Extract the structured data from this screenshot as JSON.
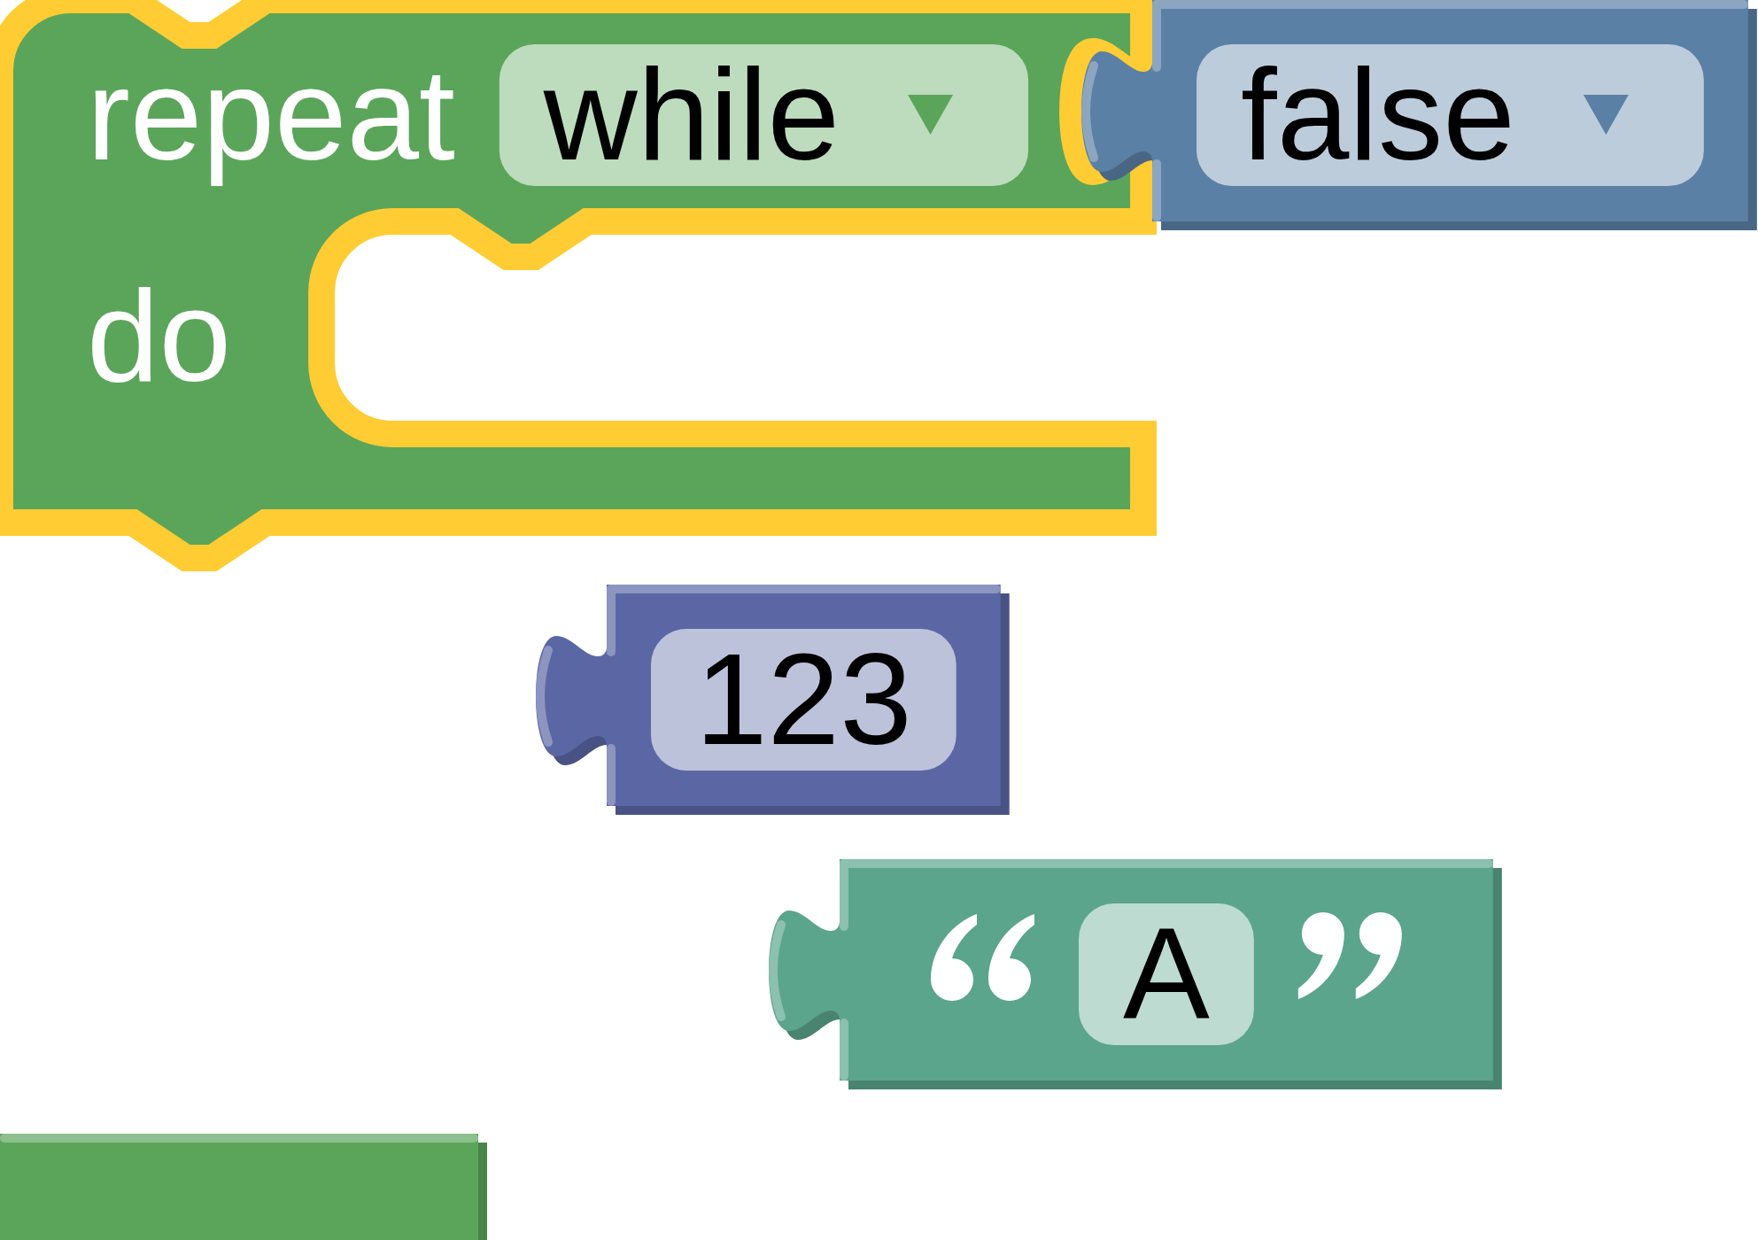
{
  "workspace": {
    "blocks": [
      {
        "kind": "loop",
        "color": "#5ba55b",
        "selected": true,
        "label": "repeat",
        "dropdown": "while",
        "input": {
          "kind": "boolean",
          "color": "#5b80a5",
          "selected": false,
          "dropdown": "false"
        },
        "statement_label": "do"
      },
      {
        "kind": "number",
        "color": "#5b67a5",
        "selected": false,
        "field": "123"
      },
      {
        "kind": "text",
        "color": "#5ba58c",
        "selected": false,
        "field": "A"
      },
      {
        "kind": "fragment",
        "color": "#5ba55b",
        "selected": false
      }
    ]
  }
}
